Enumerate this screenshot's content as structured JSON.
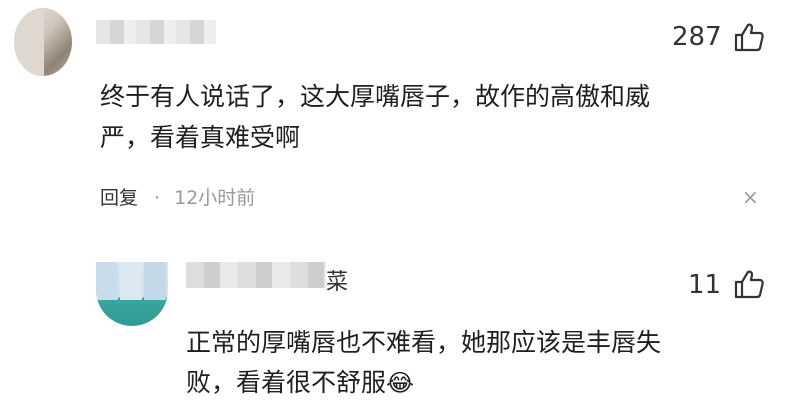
{
  "comments": [
    {
      "like_count": "287",
      "text_line1": "终于有人说话了，这大厚嘴唇子，故作的高傲和威",
      "text_line2": "严，看着真难受啊",
      "reply_label": "回复",
      "separator": "·",
      "time": "12小时前",
      "close_icon": "×"
    },
    {
      "name_tail": "菜",
      "like_count": "11",
      "text_line1": "正常的厚嘴唇也不难看，她那应该是丰唇失",
      "text_line2": "败，看着很不舒服",
      "emoji": "😂"
    }
  ]
}
